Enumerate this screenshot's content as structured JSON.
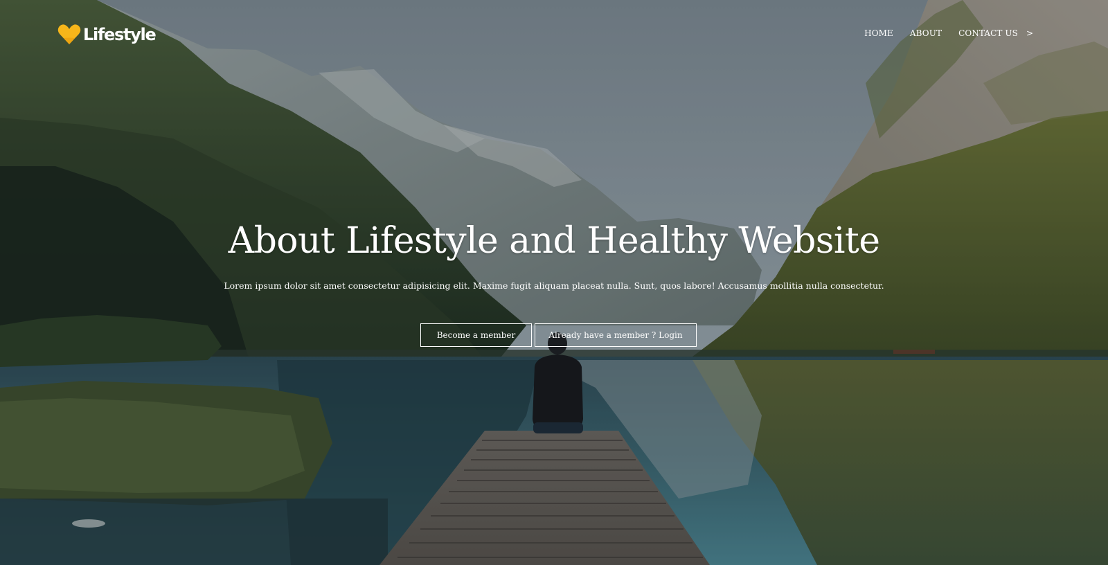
{
  "brand": {
    "name": "Lifestyle",
    "icon": "heart-icon",
    "accent_color": "#f7b61a"
  },
  "nav": {
    "items": [
      {
        "label": "HOME"
      },
      {
        "label": "ABOUT"
      },
      {
        "label": "CONTACT US"
      }
    ],
    "arrow": ">"
  },
  "hero": {
    "title": "About Lifestyle and Healthy Website",
    "subtitle": "Lorem ipsum dolor sit amet consectetur adipisicing elit. Maxime fugit aliquam placeat nulla. Sunt, quos labore! Accusamus mollitia nulla consectetur.",
    "buttons": {
      "member": "Become a member",
      "login": "Already have a member ? Login"
    }
  },
  "background": {
    "description_icon": "mountain-lake-photo-icon"
  }
}
